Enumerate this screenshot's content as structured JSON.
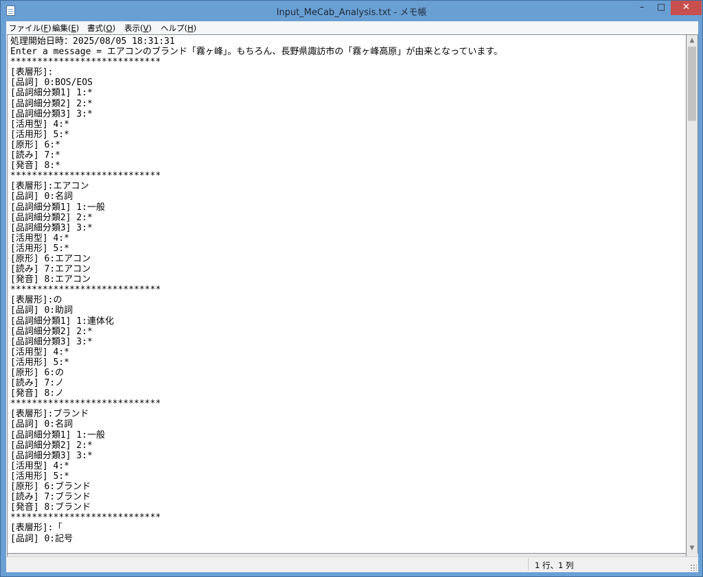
{
  "window": {
    "title": "Input_MeCab_Analysis.txt - メモ帳",
    "controls": {
      "minimize": "–",
      "maximize": "□",
      "close": "✕"
    }
  },
  "menu": [
    {
      "label": "ファイル(",
      "key": "F",
      "end": ")"
    },
    {
      "label": "編集(",
      "key": "E",
      "end": ")"
    },
    {
      "label": "書式(",
      "key": "O",
      "end": ")"
    },
    {
      "label": "表示(",
      "key": "V",
      "end": ")"
    },
    {
      "label": "ヘルプ(",
      "key": "H",
      "end": ")"
    }
  ],
  "editor": {
    "lines": [
      "処理開始日時：2025/08/05 18:31:31",
      "Enter a message = エアコンのブランド「霧ヶ峰」。もちろん、長野県諏訪市の「霧ヶ峰高原」が由来となっています。",
      "****************************",
      "[表層形]:",
      "[品詞] 0:BOS/EOS",
      "[品詞細分類1] 1:*",
      "[品詞細分類2] 2:*",
      "[品詞細分類3] 3:*",
      "[活用型] 4:*",
      "[活用形] 5:*",
      "[原形] 6:*",
      "[読み] 7:*",
      "[発音] 8:*",
      "****************************",
      "[表層形]:エアコン",
      "[品詞] 0:名詞",
      "[品詞細分類1] 1:一般",
      "[品詞細分類2] 2:*",
      "[品詞細分類3] 3:*",
      "[活用型] 4:*",
      "[活用形] 5:*",
      "[原形] 6:エアコン",
      "[読み] 7:エアコン",
      "[発音] 8:エアコン",
      "****************************",
      "[表層形]:の",
      "[品詞] 0:助詞",
      "[品詞細分類1] 1:連体化",
      "[品詞細分類2] 2:*",
      "[品詞細分類3] 3:*",
      "[活用型] 4:*",
      "[活用形] 5:*",
      "[原形] 6:の",
      "[読み] 7:ノ",
      "[発音] 8:ノ",
      "****************************",
      "[表層形]:ブランド",
      "[品詞] 0:名詞",
      "[品詞細分類1] 1:一般",
      "[品詞細分類2] 2:*",
      "[品詞細分類3] 3:*",
      "[活用型] 4:*",
      "[活用形] 5:*",
      "[原形] 6:ブランド",
      "[読み] 7:ブランド",
      "[発音] 8:ブランド",
      "****************************",
      "[表層形]:「",
      "[品詞] 0:記号"
    ]
  },
  "status": {
    "position": "1 行、1 列"
  }
}
